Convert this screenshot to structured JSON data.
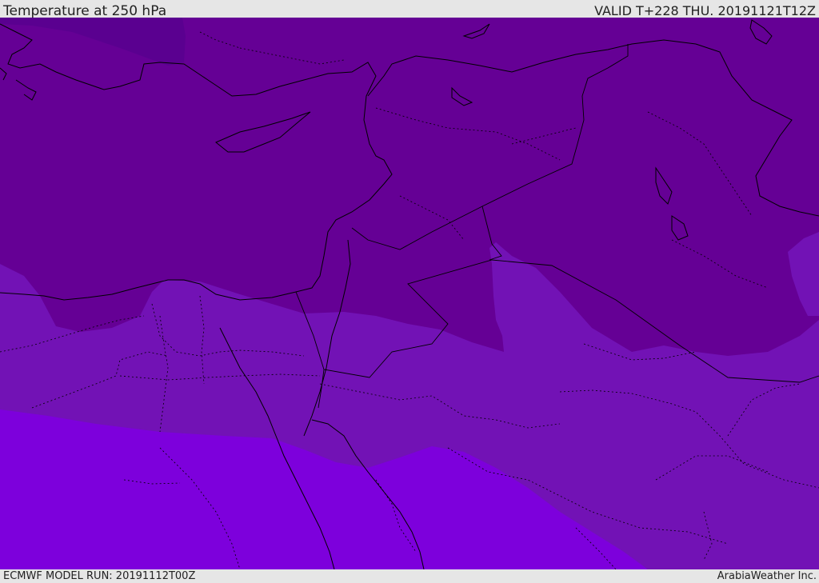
{
  "header": {
    "title": "Temperature at 250 hPa",
    "valid": "VALID T+228 THU. 20191121T12Z"
  },
  "footer": {
    "model_run": "ECMWF MODEL RUN: 20191112T00Z",
    "credit": "ArabiaWeather Inc."
  },
  "colors": {
    "band_coldest": "#5a0090",
    "band_cold": "#650095",
    "band_mid": "#7212b5",
    "band_warm": "#7d00dc",
    "border_line": "#000000",
    "bar_background": "#e6e6e6"
  }
}
